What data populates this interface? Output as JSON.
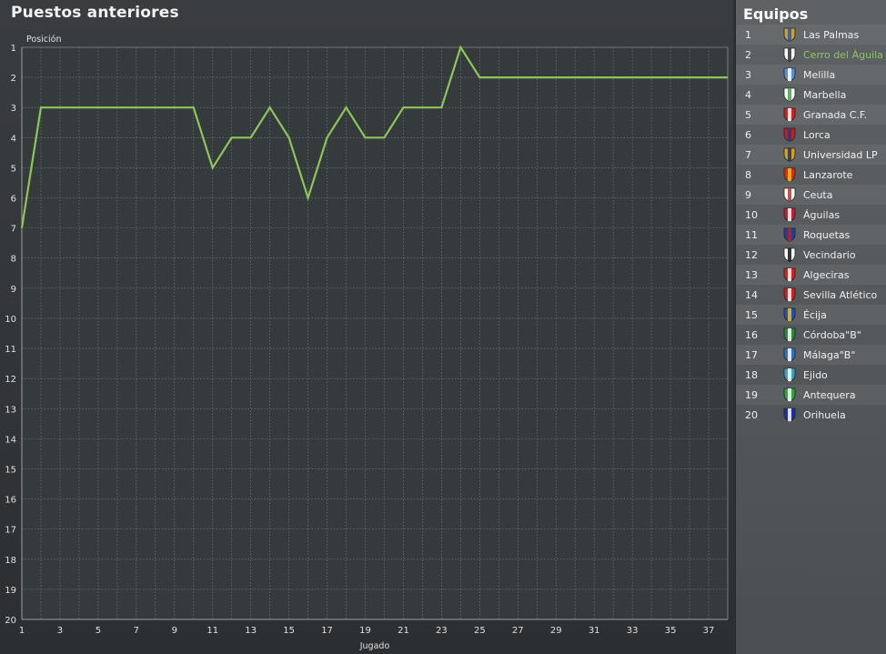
{
  "panel": {
    "title": "Puestos anteriores"
  },
  "sidebar": {
    "title": "Equipos",
    "teams": [
      {
        "pos": "1",
        "name": "Las Palmas",
        "c1": "#c9a227",
        "c2": "#2a55b0"
      },
      {
        "pos": "2",
        "name": "Cerro del Águila",
        "c1": "#ffffff",
        "c2": "#333333",
        "highlight": true
      },
      {
        "pos": "3",
        "name": "Melilla",
        "c1": "#5a8fd0",
        "c2": "#ffffff"
      },
      {
        "pos": "4",
        "name": "Marbella",
        "c1": "#ffffff",
        "c2": "#4aa04a"
      },
      {
        "pos": "5",
        "name": "Granada C.F.",
        "c1": "#d02020",
        "c2": "#ffffff"
      },
      {
        "pos": "6",
        "name": "Lorca",
        "c1": "#c02020",
        "c2": "#2a3a80"
      },
      {
        "pos": "7",
        "name": "Universidad LP",
        "c1": "#d4a020",
        "c2": "#203060"
      },
      {
        "pos": "8",
        "name": "Lanzarote",
        "c1": "#d03010",
        "c2": "#f0c020"
      },
      {
        "pos": "9",
        "name": "Ceuta",
        "c1": "#ffffff",
        "c2": "#c03030"
      },
      {
        "pos": "10",
        "name": "Águilas",
        "c1": "#c02030",
        "c2": "#ffffff"
      },
      {
        "pos": "11",
        "name": "Roquetas",
        "c1": "#2040a0",
        "c2": "#c02020"
      },
      {
        "pos": "12",
        "name": "Vecindario",
        "c1": "#ffffff",
        "c2": "#111111"
      },
      {
        "pos": "13",
        "name": "Algeciras",
        "c1": "#d02020",
        "c2": "#ffffff"
      },
      {
        "pos": "14",
        "name": "Sevilla Atlético",
        "c1": "#d02020",
        "c2": "#ffffff"
      },
      {
        "pos": "15",
        "name": "Écija",
        "c1": "#2050b0",
        "c2": "#f0c020"
      },
      {
        "pos": "16",
        "name": "Córdoba\"B\"",
        "c1": "#2a8a3a",
        "c2": "#ffffff"
      },
      {
        "pos": "17",
        "name": "Málaga\"B\"",
        "c1": "#3070c0",
        "c2": "#ffffff"
      },
      {
        "pos": "18",
        "name": "Ejido",
        "c1": "#40a0c0",
        "c2": "#ffffff"
      },
      {
        "pos": "19",
        "name": "Antequera",
        "c1": "#30a040",
        "c2": "#ffffff"
      },
      {
        "pos": "20",
        "name": "Orihuela",
        "c1": "#2030a0",
        "c2": "#ffffff"
      }
    ]
  },
  "chart_data": {
    "type": "line",
    "ylabel": "Posición",
    "xlabel": "Jugado",
    "xlim": [
      1,
      38
    ],
    "ylim": [
      1,
      20
    ],
    "y_inverted": true,
    "x_tick_labels": [
      "1",
      "3",
      "5",
      "7",
      "9",
      "11",
      "13",
      "15",
      "17",
      "19",
      "21",
      "23",
      "25",
      "27",
      "29",
      "31",
      "33",
      "35",
      "37"
    ],
    "y_tick_labels": [
      "1",
      "2",
      "3",
      "4",
      "5",
      "6",
      "7",
      "8",
      "9",
      "10",
      "11",
      "12",
      "13",
      "14",
      "15",
      "16",
      "17",
      "18",
      "19",
      "20"
    ],
    "grid": true,
    "line_color": "#8fc65a",
    "series": [
      {
        "x": [
          1,
          2,
          3,
          4,
          5,
          6,
          7,
          8,
          9,
          10,
          11,
          12,
          13,
          14,
          15,
          16,
          17,
          18,
          19,
          20,
          21,
          22,
          23,
          24,
          25,
          26,
          27,
          28,
          29,
          30,
          31,
          32,
          33,
          34,
          35,
          36,
          37,
          38
        ],
        "values": [
          7,
          3,
          3,
          3,
          3,
          3,
          3,
          3,
          3,
          3,
          5,
          4,
          4,
          3,
          4,
          6,
          4,
          3,
          4,
          4,
          3,
          3,
          3,
          1,
          2,
          2,
          2,
          2,
          2,
          2,
          2,
          2,
          2,
          2,
          2,
          2,
          2,
          2
        ]
      }
    ]
  }
}
